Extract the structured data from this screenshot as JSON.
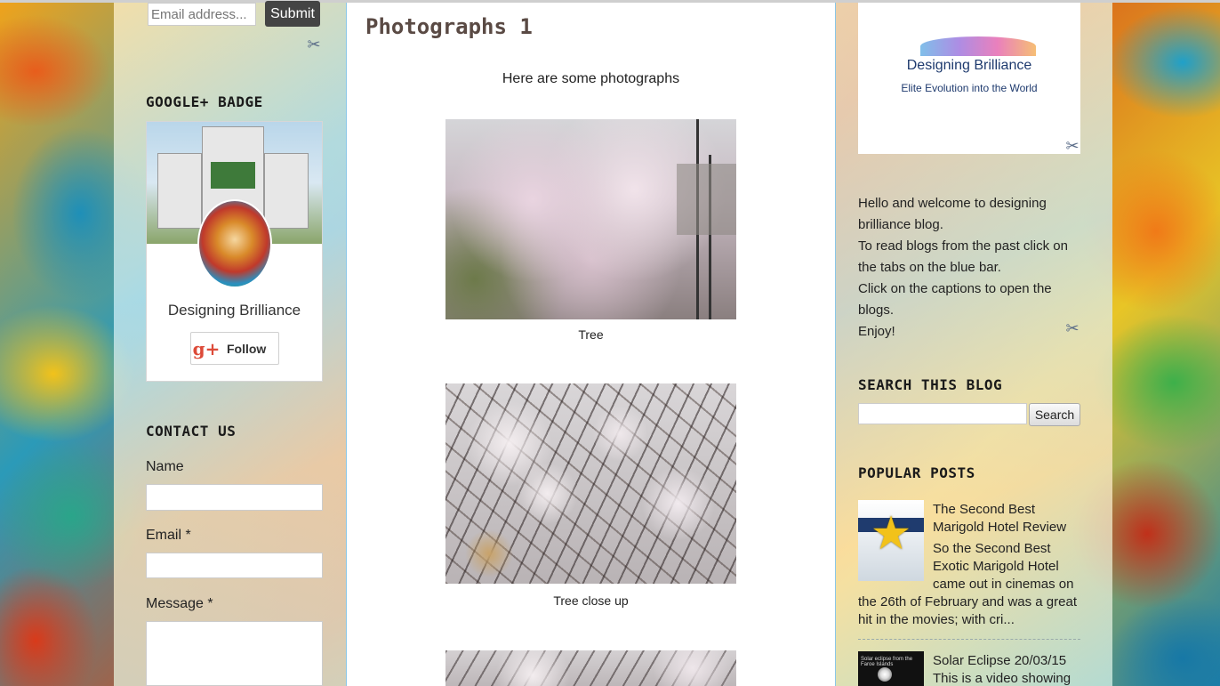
{
  "subscribe": {
    "email_placeholder": "Email address...",
    "submit_label": "Submit"
  },
  "gplus_badge": {
    "title": "Google+ Badge",
    "name": "Designing Brilliance",
    "follow_label": "Follow",
    "g_glyph": "g+"
  },
  "contact": {
    "title": "Contact Us",
    "name_label": "Name",
    "email_label": "Email *",
    "message_label": "Message *"
  },
  "post": {
    "title": "Photographs 1",
    "intro": "Here are some photographs",
    "photos": [
      {
        "caption": "Tree"
      },
      {
        "caption": "Tree close up"
      },
      {
        "caption": ""
      }
    ]
  },
  "brand": {
    "name": "Designing Brilliance",
    "tagline": "Elite Evolution into the World"
  },
  "welcome": {
    "lines": [
      "Hello and welcome to designing brilliance blog.",
      "To read blogs from the past click on the tabs on the blue bar.",
      "Click on the captions to open the blogs.",
      "Enjoy!"
    ]
  },
  "search": {
    "title": "Search This Blog",
    "button_label": "Search"
  },
  "popular_posts": {
    "title": "Popular Posts",
    "items": [
      {
        "title": "The Second Best Marigold Hotel Review",
        "snippet_top": "So the Second Best Exotic Marigold Hotel came out in cinemas on",
        "snippet_rest": "the 26th of February and was a great hit in the movies; with cri..."
      },
      {
        "title": "Solar Eclipse 20/03/15",
        "snippet_top": "This is a video showing",
        "thumb_caption": "Solar eclipse from the Faroe Islands"
      }
    ]
  },
  "colors": {
    "accent_blue": "#8ac7e8",
    "gplus_red": "#dd4b39",
    "brand_navy": "#1e3a6e"
  },
  "icons": {
    "wrench": "wrench-screwdriver-icon",
    "star": "star-icon"
  }
}
